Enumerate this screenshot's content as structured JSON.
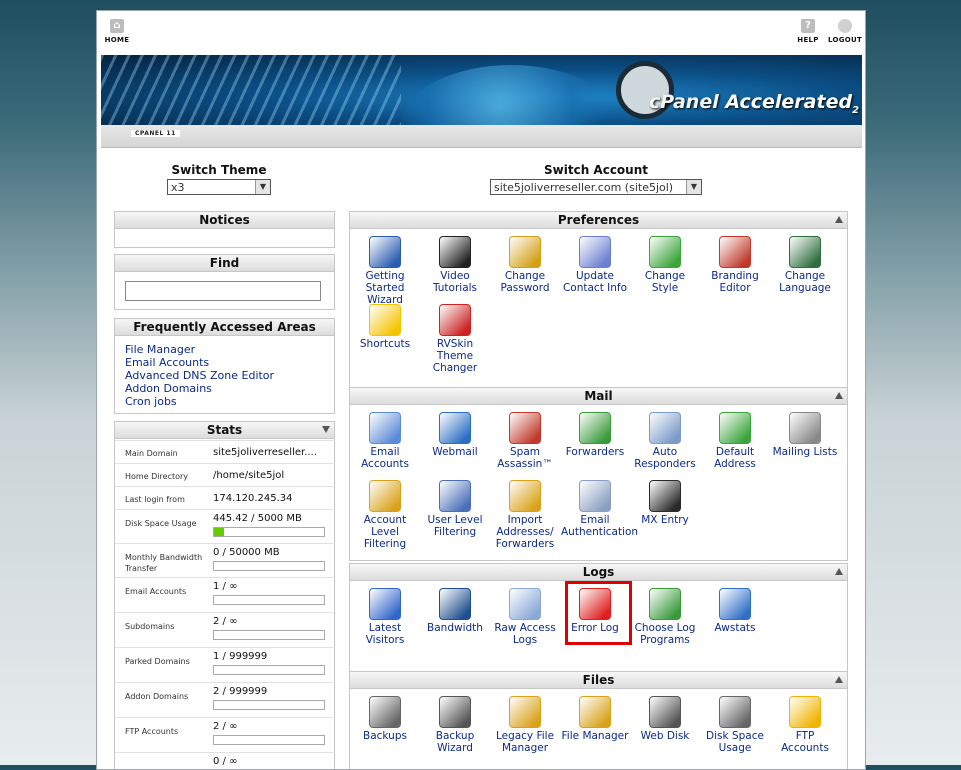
{
  "topbar": {
    "home": "HOME",
    "help": "HELP",
    "logout": "LOGOUT"
  },
  "banner": {
    "brand": "cPanel",
    "accel": "Accelerated",
    "version": "2",
    "subtitle": "CPANEL 11"
  },
  "switch_theme": {
    "title": "Switch Theme",
    "value": "x3"
  },
  "switch_account": {
    "title": "Switch Account",
    "value": "site5joliverreseller.com (site5jol)"
  },
  "notices": {
    "title": "Notices"
  },
  "find": {
    "title": "Find"
  },
  "frequent": {
    "title": "Frequently Accessed Areas",
    "links": [
      "File Manager",
      "Email Accounts",
      "Advanced DNS Zone Editor",
      "Addon Domains",
      "Cron jobs"
    ]
  },
  "stats": {
    "title": "Stats",
    "rows": [
      {
        "k": "Main Domain",
        "v": "site5joliverreseller...."
      },
      {
        "k": "Home Directory",
        "v": "/home/site5jol"
      },
      {
        "k": "Last login from",
        "v": "174.120.245.34"
      },
      {
        "k": "Disk Space Usage",
        "v": "445.42 / 5000 MB",
        "fill": 0.089
      },
      {
        "k": "Monthly Bandwidth Transfer",
        "v": "0 / 50000 MB",
        "fill": 0
      },
      {
        "k": "Email Accounts",
        "v": "1 / ∞",
        "fill": 0
      },
      {
        "k": "Subdomains",
        "v": "2 / ∞",
        "fill": 0
      },
      {
        "k": "Parked Domains",
        "v": "1 / 999999",
        "fill": 0
      },
      {
        "k": "Addon Domains",
        "v": "2 / 999999",
        "fill": 0
      },
      {
        "k": "FTP Accounts",
        "v": "2 / ∞",
        "fill": 0
      },
      {
        "k": "",
        "v": "0 / ∞",
        "fill": 0
      }
    ]
  },
  "preferences": {
    "title": "Preferences",
    "items": [
      {
        "label": "Getting Started Wizard",
        "icon": "play-icon",
        "color": "#2a5db0"
      },
      {
        "label": "Video Tutorials",
        "icon": "clapperboard-icon",
        "color": "#222222"
      },
      {
        "label": "Change Password",
        "icon": "padlock-icon",
        "color": "#d4a017"
      },
      {
        "label": "Update Contact Info",
        "icon": "contact-card-icon",
        "color": "#6b7fd0"
      },
      {
        "label": "Change Style",
        "icon": "palette-icon",
        "color": "#3aa53a"
      },
      {
        "label": "Branding Editor",
        "icon": "brush-icon",
        "color": "#c0392b"
      },
      {
        "label": "Change Language",
        "icon": "language-icon",
        "color": "#2f6f3f"
      },
      {
        "label": "Shortcuts",
        "icon": "star-icon",
        "color": "#f5c400"
      },
      {
        "label": "RVSkin Theme Changer",
        "icon": "theme-icon",
        "color": "#cc2222"
      }
    ]
  },
  "mail": {
    "title": "Mail",
    "items": [
      {
        "label": "Email Accounts",
        "icon": "envelope-icon",
        "color": "#5b8ad6"
      },
      {
        "label": "Webmail",
        "icon": "globe-mail-icon",
        "color": "#2b6fc4"
      },
      {
        "label": "Spam Assassin™",
        "icon": "spamassassin-icon",
        "color": "#c0392b"
      },
      {
        "label": "Forwarders",
        "icon": "forward-arrow-icon",
        "color": "#3a9a3a"
      },
      {
        "label": "Auto Responders",
        "icon": "responder-icon",
        "color": "#7a9ac8"
      },
      {
        "label": "Default Address",
        "icon": "default-address-icon",
        "color": "#3aa53a"
      },
      {
        "label": "Mailing Lists",
        "icon": "mailing-list-icon",
        "color": "#888888"
      },
      {
        "label": "Account Level Filtering",
        "icon": "filter-icon",
        "color": "#d9a21a"
      },
      {
        "label": "User Level Filtering",
        "icon": "user-filter-icon",
        "color": "#4a6fb8"
      },
      {
        "label": "Import Addresses/ Forwarders",
        "icon": "import-box-icon",
        "color": "#d9a21a"
      },
      {
        "label": "Email Authentication",
        "icon": "authentication-icon",
        "color": "#8aa0c0"
      },
      {
        "label": "MX Entry",
        "icon": "mx-server-icon",
        "color": "#2a2a2a"
      }
    ]
  },
  "logs": {
    "title": "Logs",
    "items": [
      {
        "label": "Latest Visitors",
        "icon": "visitors-icon",
        "color": "#3366cc"
      },
      {
        "label": "Bandwidth",
        "icon": "bandwidth-monitor-icon",
        "color": "#1f4f8f"
      },
      {
        "label": "Raw Access Logs",
        "icon": "raw-log-icon",
        "color": "#8aa8d8"
      },
      {
        "label": "Error Log",
        "icon": "error-log-icon",
        "color": "#e02020"
      },
      {
        "label": "Choose Log Programs",
        "icon": "log-programs-icon",
        "color": "#3a9a3a"
      },
      {
        "label": "Awstats",
        "icon": "awstats-icon",
        "color": "#2f6fc8"
      }
    ]
  },
  "files": {
    "title": "Files",
    "items": [
      {
        "label": "Backups",
        "icon": "backup-drive-icon",
        "color": "#666666"
      },
      {
        "label": "Backup Wizard",
        "icon": "backup-wizard-icon",
        "color": "#555555"
      },
      {
        "label": "Legacy File Manager",
        "icon": "legacy-folder-icon",
        "color": "#d9a21a"
      },
      {
        "label": "File Manager",
        "icon": "folder-icon",
        "color": "#d9a21a"
      },
      {
        "label": "Web Disk",
        "icon": "web-disk-icon",
        "color": "#555555"
      },
      {
        "label": "Disk Space Usage",
        "icon": "disk-usage-icon",
        "color": "#666666"
      },
      {
        "label": "FTP Accounts",
        "icon": "ftp-icon",
        "color": "#f0b400"
      }
    ]
  }
}
